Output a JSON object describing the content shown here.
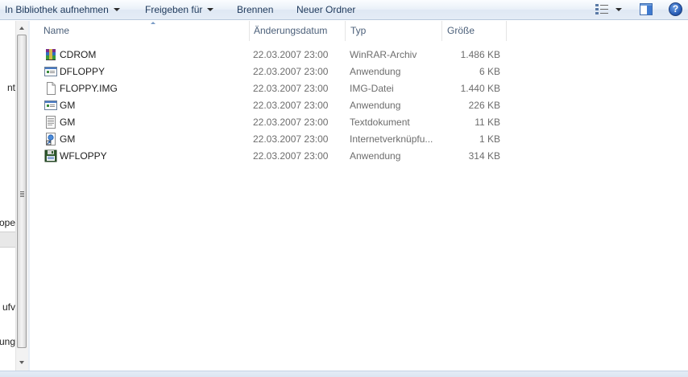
{
  "toolbar": {
    "include_library": "In Bibliothek aufnehmen",
    "share_with": "Freigeben für",
    "burn": "Brennen",
    "new_folder": "Neuer Ordner",
    "help": "?"
  },
  "nav": {
    "partial_labels": [
      "nt",
      "ope",
      "ufv",
      "ung"
    ]
  },
  "columns": {
    "name": "Name",
    "date": "Änderungsdatum",
    "type": "Typ",
    "size": "Größe"
  },
  "files": [
    {
      "name": "CDROM",
      "date": "22.03.2007 23:00",
      "type": "WinRAR-Archiv",
      "size": "1.486 KB",
      "icon": "winrar-archive-icon"
    },
    {
      "name": "DFLOPPY",
      "date": "22.03.2007 23:00",
      "type": "Anwendung",
      "size": "6 KB",
      "icon": "application-icon"
    },
    {
      "name": "FLOPPY.IMG",
      "date": "22.03.2007 23:00",
      "type": "IMG-Datei",
      "size": "1.440 KB",
      "icon": "blank-file-icon"
    },
    {
      "name": "GM",
      "date": "22.03.2007 23:00",
      "type": "Anwendung",
      "size": "226 KB",
      "icon": "application-icon"
    },
    {
      "name": "GM",
      "date": "22.03.2007 23:00",
      "type": "Textdokument",
      "size": "11 KB",
      "icon": "text-document-icon"
    },
    {
      "name": "GM",
      "date": "22.03.2007 23:00",
      "type": "Internetverknüpfu...",
      "size": "1 KB",
      "icon": "internet-shortcut-icon"
    },
    {
      "name": "WFLOPPY",
      "date": "22.03.2007 23:00",
      "type": "Anwendung",
      "size": "314 KB",
      "icon": "floppy-application-icon"
    }
  ],
  "colors": {
    "toolbar_text": "#1e395b",
    "header_text": "#4c607a",
    "detail_text": "#6d6d6d"
  }
}
